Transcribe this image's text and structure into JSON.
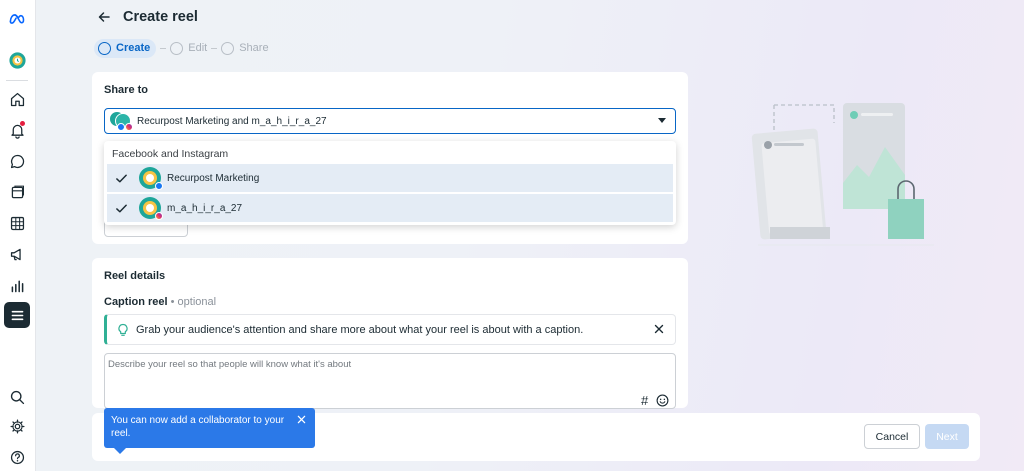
{
  "header": {
    "title": "Create reel",
    "steps": [
      {
        "label": "Create",
        "active": true
      },
      {
        "label": "Edit",
        "active": false
      },
      {
        "label": "Share",
        "active": false
      }
    ]
  },
  "share_to": {
    "title": "Share to",
    "selected_text": "Recurpost Marketing and m_a_h_i_r_a_27",
    "dropdown": {
      "group_label": "Facebook and Instagram",
      "options": [
        {
          "label": "Recurpost Marketing",
          "checked": true,
          "platform": "facebook"
        },
        {
          "label": "m_a_h_i_r_a_27",
          "checked": true,
          "platform": "instagram"
        }
      ]
    }
  },
  "reel_details": {
    "title": "Reel details",
    "caption_label": "Caption reel",
    "caption_optional": "• optional",
    "tip": "Grab your audience's attention and share more about what your reel is about with a caption.",
    "caption_placeholder": "Describe your reel so that people will know what it's about",
    "hashtag_symbol": "#"
  },
  "toast": {
    "text": "You can now add a collaborator to your reel."
  },
  "footer": {
    "cancel_label": "Cancel",
    "next_label": "Next"
  },
  "colors": {
    "accent": "#0866c6",
    "toast": "#2b79e8",
    "tip_accent": "#30b095",
    "rail_active": "#1c2b33",
    "notification_dot": "#e41e3f"
  },
  "sidebar_icons": [
    "meta-logo-icon",
    "profile-avatar",
    "home-icon",
    "bell-icon",
    "chat-icon",
    "pages-icon",
    "table-icon",
    "megaphone-icon",
    "insights-icon",
    "menu-icon",
    "search-icon",
    "gear-icon",
    "help-icon"
  ]
}
